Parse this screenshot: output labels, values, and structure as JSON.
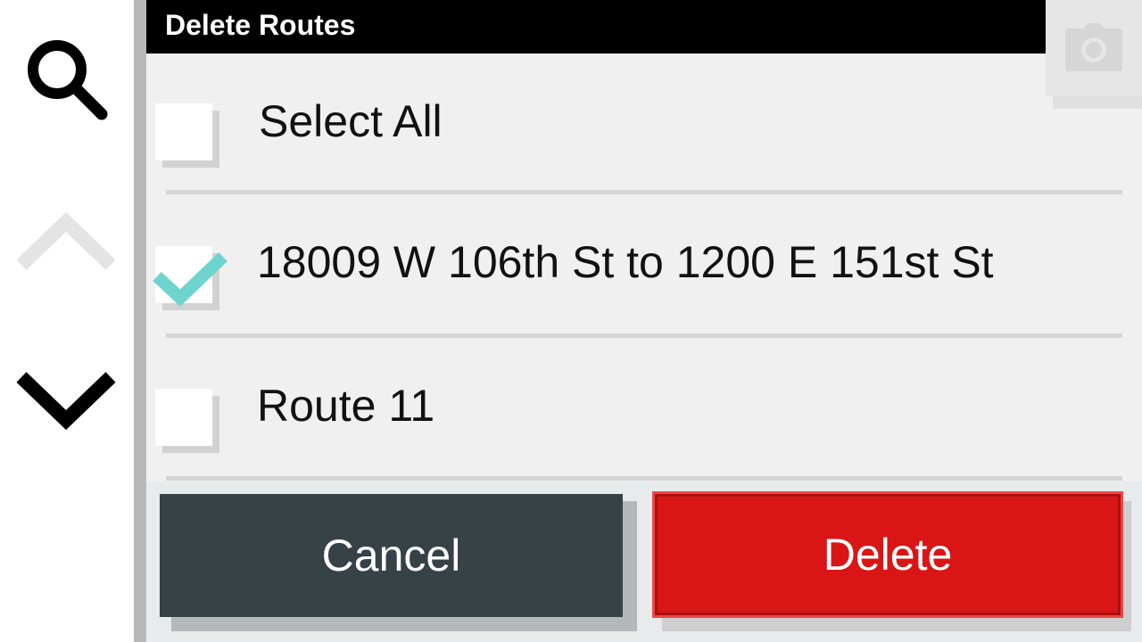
{
  "sidebar": {
    "search_icon": "search-icon",
    "up_icon": "chevron-up-icon",
    "down_icon": "chevron-down-icon"
  },
  "dialog": {
    "title": "Delete Routes",
    "camera_icon": "camera-icon"
  },
  "rows": [
    {
      "label": "Select All",
      "checked": false
    },
    {
      "label": "18009 W 106th St to 1200 E 151st St",
      "checked": true
    },
    {
      "label": "Route 11",
      "checked": false
    }
  ],
  "buttons": {
    "cancel_label": "Cancel",
    "delete_label": "Delete"
  },
  "colors": {
    "check": "#6fd4ce",
    "cancel_bg": "#374246",
    "delete_bg": "#d91515",
    "delete_border": "#f04545",
    "title_bg": "#000000"
  }
}
